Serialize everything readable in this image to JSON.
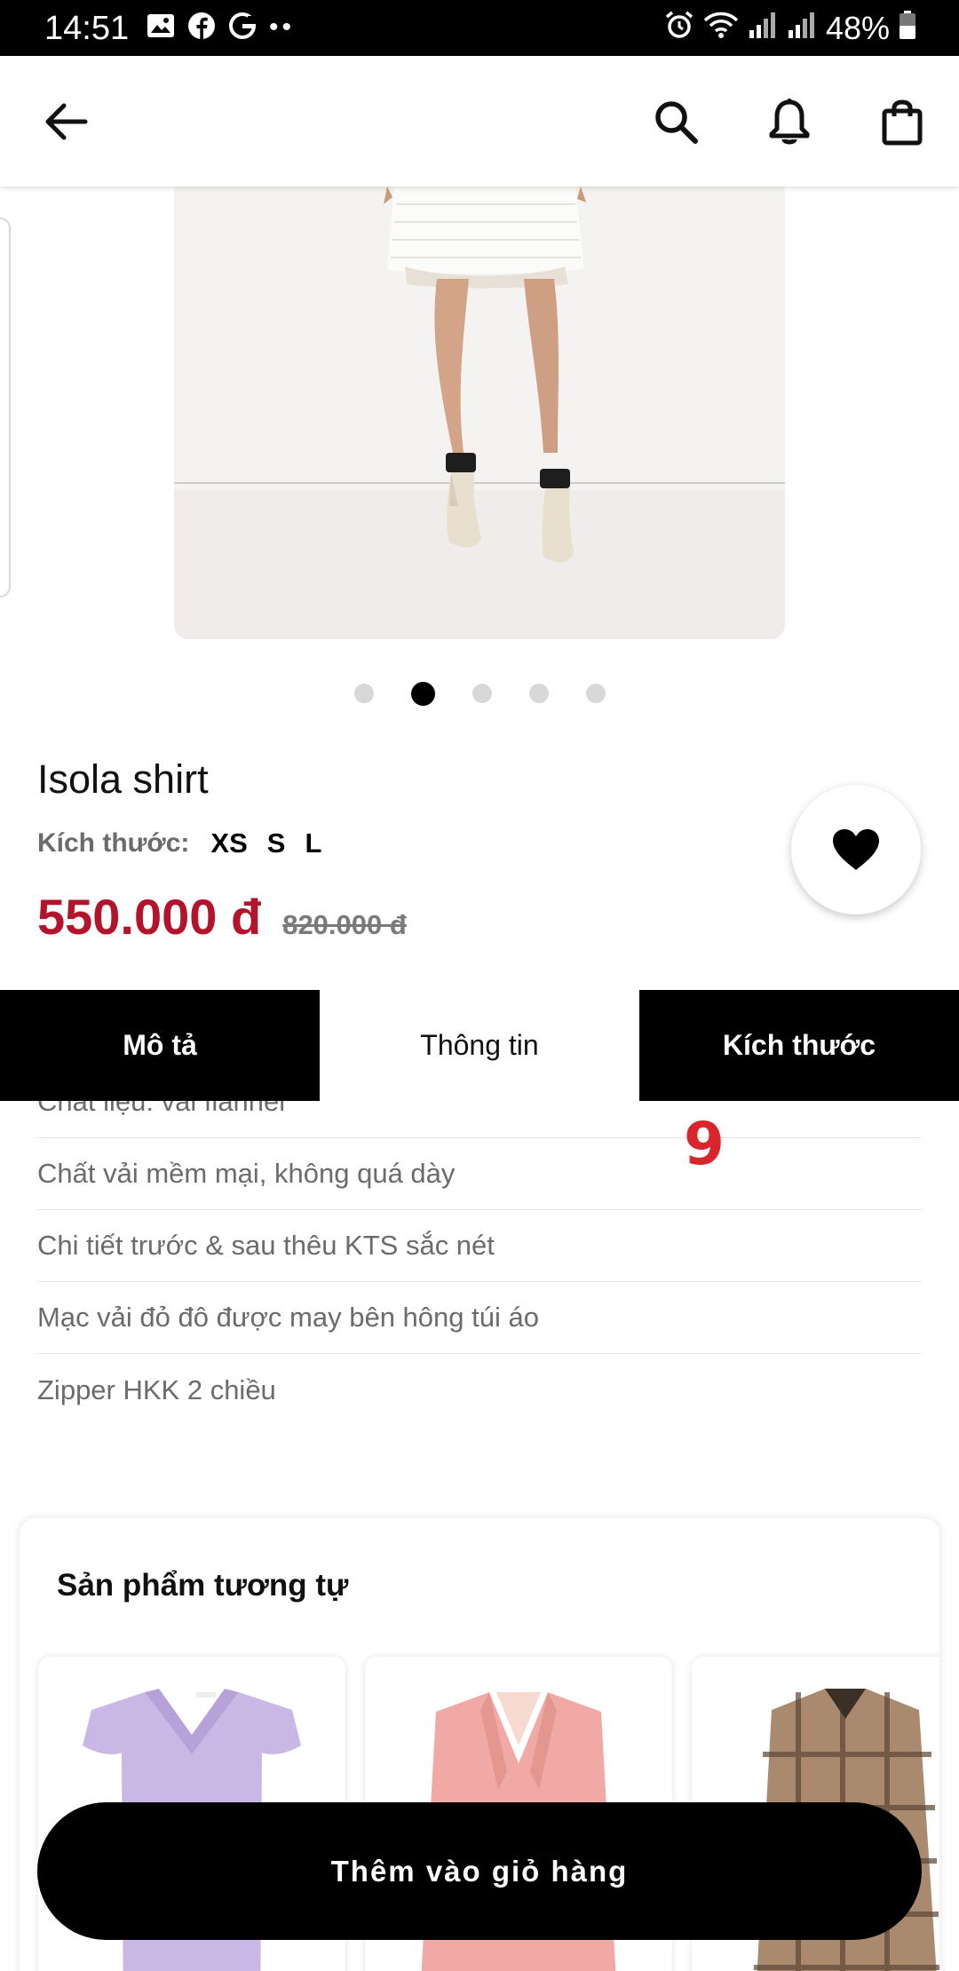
{
  "status_bar": {
    "time": "14:51",
    "battery": "48%",
    "icons": [
      "image-icon",
      "facebook-icon",
      "g-icon",
      "more-dots-icon",
      "alarm-icon",
      "wifi-icon",
      "signal-icon",
      "battery-icon"
    ]
  },
  "app_bar": {
    "icons": [
      "back-arrow-icon",
      "search-icon",
      "bell-icon",
      "shopping-bag-icon"
    ]
  },
  "product": {
    "name": "Isola shirt",
    "size_label": "Kích thước:",
    "sizes": [
      "XS",
      "S",
      "L"
    ],
    "price": "550.000 đ",
    "old_price": "820.000 đ",
    "image_count": 5,
    "active_image_index": 1
  },
  "tabs": [
    {
      "label": "Mô tả",
      "selected": false
    },
    {
      "label": "Thông tin",
      "selected": true
    },
    {
      "label": "Kích thước",
      "selected": false
    }
  ],
  "info": {
    "items": [
      "Chất liệu: vải flannel",
      "Chất vải mềm mại, không quá dày",
      "Chi tiết trước & sau thêu KTS sắc nét",
      "Mạc vải đỏ đô được may bên hông túi áo",
      "Zipper HKK 2 chiều"
    ],
    "badge": "9"
  },
  "related": {
    "title": "Sản phẩm tương tự"
  },
  "cart_button": {
    "label": "Thêm vào giỏ hàng"
  },
  "colors": {
    "price": "#b3132b",
    "badge": "#d9262c",
    "tab_dark": "#000000"
  }
}
